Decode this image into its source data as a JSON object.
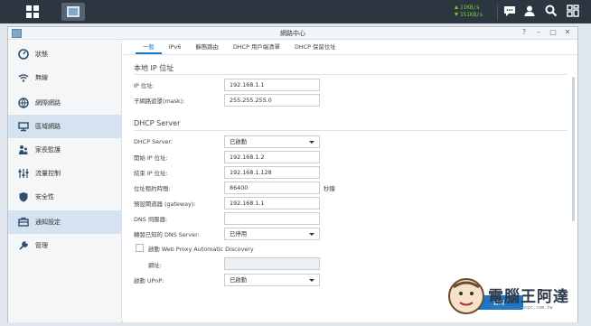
{
  "taskbar": {
    "upload_speed": "11KB/s",
    "download_speed": "151KB/s",
    "icons": [
      "apps-grid-icon",
      "network-center-app-icon",
      "chat-icon",
      "user-icon",
      "search-icon",
      "widgets-icon"
    ]
  },
  "window": {
    "title": "網路中心",
    "controls": {
      "help": "?",
      "minimize": "–",
      "maximize": "□",
      "close": "✕"
    }
  },
  "sidebar": {
    "items": [
      {
        "label": "狀態",
        "icon": "status-icon",
        "active": false
      },
      {
        "label": "無線",
        "icon": "wifi-icon",
        "active": false
      },
      {
        "label": "網際網路",
        "icon": "internet-icon",
        "active": false
      },
      {
        "label": "區域網路",
        "icon": "lan-icon",
        "active": true
      },
      {
        "label": "家長監護",
        "icon": "parental-control-icon",
        "active": false
      },
      {
        "label": "流量控制",
        "icon": "traffic-control-icon",
        "active": false
      },
      {
        "label": "安全性",
        "icon": "security-icon",
        "active": false
      },
      {
        "label": "通知設定",
        "icon": "notification-icon",
        "active": false
      },
      {
        "label": "管理",
        "icon": "management-icon",
        "active": false
      }
    ]
  },
  "tabs": [
    "一般",
    "IPv6",
    "靜態路由",
    "DHCP 用戶端清單",
    "DHCP 保留位址"
  ],
  "local_ip": {
    "section_title": "本地 IP 位址",
    "ip_label": "IP 位址:",
    "ip_value": "192.168.1.1",
    "mask_label": "子網路遮罩(mask):",
    "mask_value": "255.255.255.0"
  },
  "dhcp": {
    "section_title": "DHCP Server",
    "server_label": "DHCP Server:",
    "server_value": "已啟動",
    "start_label": "開始 IP 位址:",
    "start_value": "192.168.1.2",
    "end_label": "結束 IP 位址:",
    "end_value": "192.168.1.128",
    "lease_label": "位址租約時間:",
    "lease_value": "86400",
    "lease_unit": "秒鐘",
    "gateway_label": "預設閘道器 (gateway):",
    "gateway_value": "192.168.1.1",
    "dns_label": "DNS 伺服器:",
    "dns_value": "",
    "forward_dns_label": "轉發已知的 DNS Server:",
    "forward_dns_value": "已停用",
    "wpad_label": "啟動 Web Proxy Automatic Discovery",
    "wpad_checked": false,
    "url_label": "網址:",
    "url_value": "",
    "upnp_label": "啟動 UPnP:",
    "upnp_value": "已啟動"
  },
  "actions": {
    "apply": "套用"
  },
  "watermark": {
    "text": "電腦王阿達",
    "url": "http://www.kocpc.com.tw"
  }
}
